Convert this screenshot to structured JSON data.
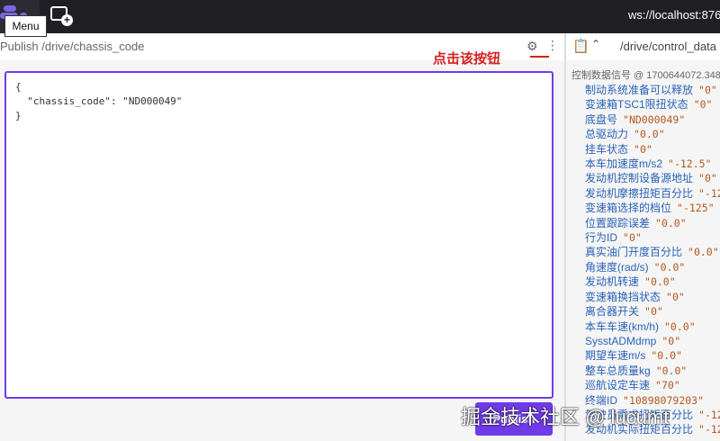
{
  "topbar": {
    "tooltip": "Menu",
    "connection": "ws://localhost:876"
  },
  "publish_panel": {
    "title": "Publish /drive/chassis_code",
    "annotation": "点击该按钮",
    "editor_text": "{\n  \"chassis_code\": \"ND000049\"\n}",
    "publish_label": "Publish"
  },
  "raw_panel": {
    "topic": "/drive/control_data",
    "message_title": "控制数据信号 @ 1700644072.348",
    "rows": [
      {
        "k": "制动系统准备可以释放",
        "v": "\"0\""
      },
      {
        "k": "变速箱TSC1限扭状态",
        "v": "\"0\""
      },
      {
        "k": "底盘号",
        "v": "\"ND000049\""
      },
      {
        "k": "总驱动力",
        "v": "\"0.0\""
      },
      {
        "k": "挂车状态",
        "v": "\"0\""
      },
      {
        "k": "本车加速度m/s2",
        "v": "\"-12.5\""
      },
      {
        "k": "发动机控制设备源地址",
        "v": "\"0\""
      },
      {
        "k": "发动机摩擦扭矩百分比",
        "v": "\"-12"
      },
      {
        "k": "变速箱选择的档位",
        "v": "\"-125\""
      },
      {
        "k": "位置跟踪误差",
        "v": "\"0.0\""
      },
      {
        "k": "行为ID",
        "v": "\"0\""
      },
      {
        "k": "真实油门开度百分比",
        "v": "\"0.0\""
      },
      {
        "k": "角速度(rad/s)",
        "v": "\"0.0\""
      },
      {
        "k": "发动机转速",
        "v": "\"0.0\""
      },
      {
        "k": "变速箱换挡状态",
        "v": "\"0\""
      },
      {
        "k": "离合器开关",
        "v": "\"0\""
      },
      {
        "k": "本车车速(km/h)",
        "v": "\"0.0\""
      },
      {
        "k": "SysstADMdmp",
        "v": "\"0\""
      },
      {
        "k": "期望车速m/s",
        "v": "\"0.0\""
      },
      {
        "k": "整车总质量kg",
        "v": "\"0.0\""
      },
      {
        "k": "巡航设定车速",
        "v": "\"70\""
      },
      {
        "k": "终端ID",
        "v": "\"10898079203\""
      },
      {
        "k": "驾驶员需求扭矩百分比",
        "v": "\"-12"
      },
      {
        "k": "发动机实际扭矩百分比",
        "v": "\"-12"
      }
    ]
  },
  "watermark": "掘金技术社区 @ lucumt"
}
